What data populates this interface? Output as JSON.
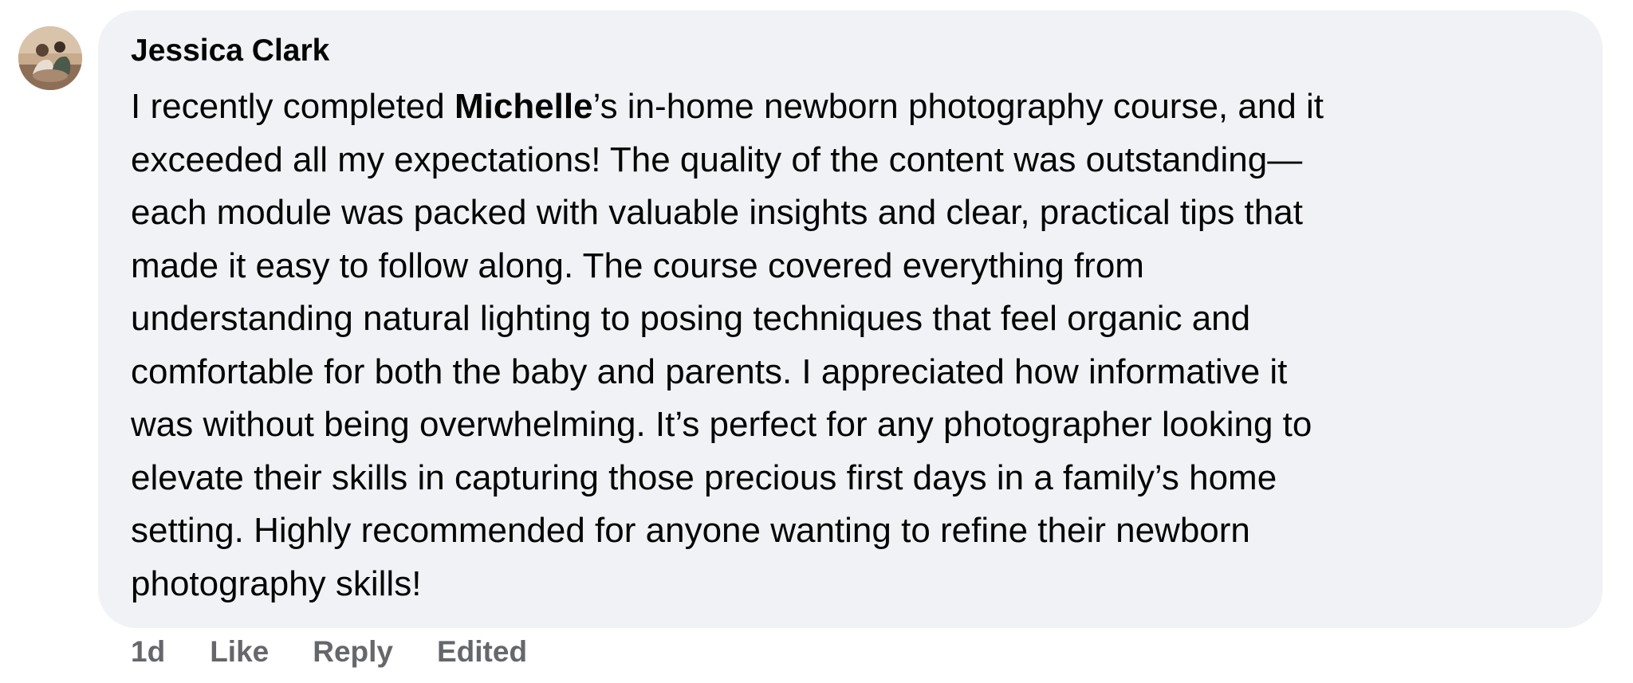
{
  "comment": {
    "author": "Jessica Clark",
    "avatar_icon": "profile-photo",
    "body": {
      "lines": [
        {
          "before": "I recently completed ",
          "mention": "Michelle",
          "after": "’s in-home newborn photography course, and it"
        },
        {
          "text": "exceeded all my expectations! The quality of the content was outstanding—"
        },
        {
          "text": "each module was packed with valuable insights and clear, practical tips that"
        },
        {
          "text": "made it easy to follow along. The course covered everything from"
        },
        {
          "text": "understanding natural lighting to posing techniques that feel organic and"
        },
        {
          "text": "comfortable for both the baby and parents. I appreciated how informative it"
        },
        {
          "text": "was without being overwhelming. It’s perfect for any photographer looking to"
        },
        {
          "text": "elevate their skills in capturing those precious first days in a family’s home"
        },
        {
          "text": "setting. Highly recommended for anyone wanting to refine their newborn"
        },
        {
          "text": "photography skills!"
        }
      ]
    },
    "actions": {
      "timestamp": "1d",
      "like_label": "Like",
      "reply_label": "Reply",
      "edited_label": "Edited"
    }
  },
  "colors": {
    "bubble_background": "#f0f2f5",
    "text_primary": "#050505",
    "text_secondary": "#65676b"
  }
}
